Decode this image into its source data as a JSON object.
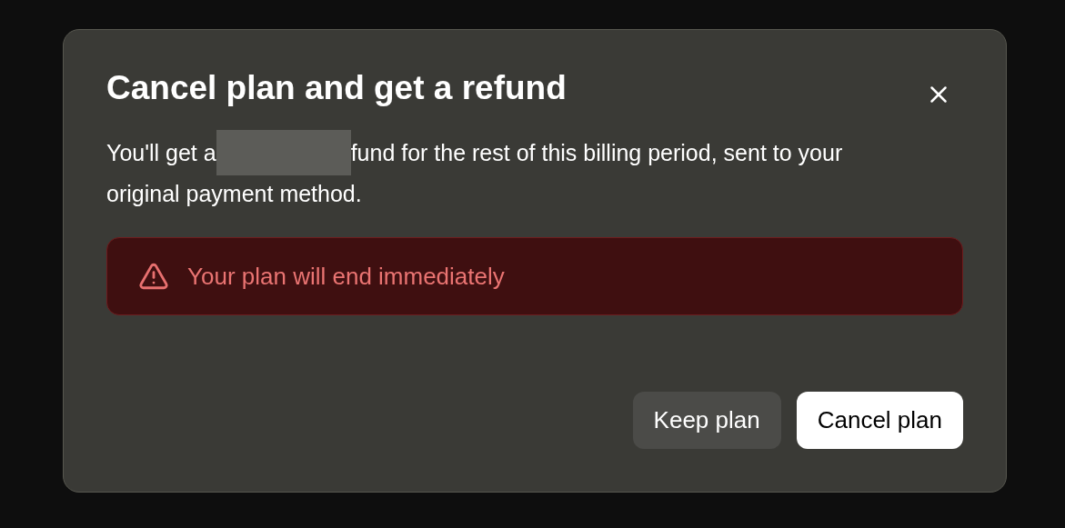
{
  "dialog": {
    "title": "Cancel plan and get a refund",
    "body_start": "You'll get a",
    "body_end": [
      "fund for the rest of this billing period, sent to your",
      "original payment method."
    ],
    "alert": {
      "text": "Your plan will end immediately"
    },
    "buttons": [
      {
        "label": "Keep plan",
        "kind": "secondary"
      },
      {
        "label": "Cancel plan",
        "kind": "primary"
      }
    ]
  }
}
